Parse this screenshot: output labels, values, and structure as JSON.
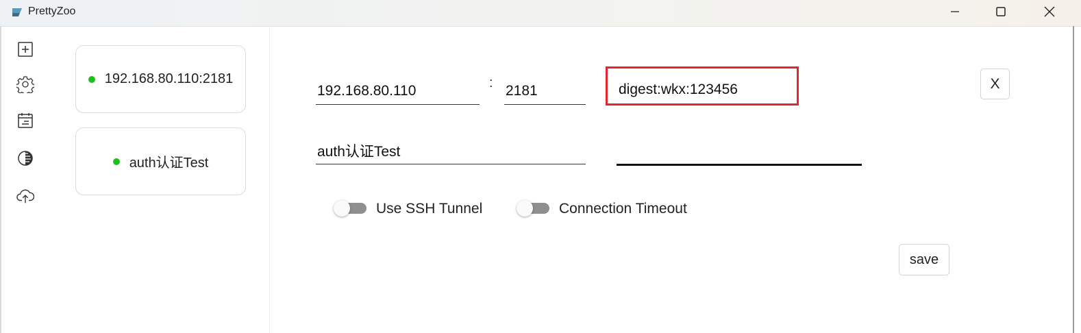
{
  "window": {
    "title": "PrettyZoo",
    "controls": {
      "minimize": "minimize",
      "maximize": "maximize",
      "close": "close"
    }
  },
  "rail": {
    "icons": [
      "add-server-icon",
      "settings-icon",
      "log-icon",
      "theme-icon",
      "upload-cloud-icon"
    ]
  },
  "servers": [
    {
      "label": "192.168.80.110:2181",
      "status": "connected",
      "status_color": "#1ec01e"
    },
    {
      "label": "auth认证Test",
      "status": "connected",
      "status_color": "#1ec01e"
    }
  ],
  "form": {
    "host_value": "192.168.80.110",
    "port_separator": ":",
    "port_value": "2181",
    "acl_value": "digest:wkx:123456",
    "alias_value": "auth认证Test",
    "password_value": "",
    "close_label": "X",
    "ssh_tunnel": {
      "label": "Use SSH Tunnel",
      "enabled": false
    },
    "connection_timeout": {
      "label": "Connection Timeout",
      "enabled": false
    },
    "save_label": "save"
  },
  "colors": {
    "highlight": "#e2262b",
    "status_green": "#1ec01e"
  }
}
